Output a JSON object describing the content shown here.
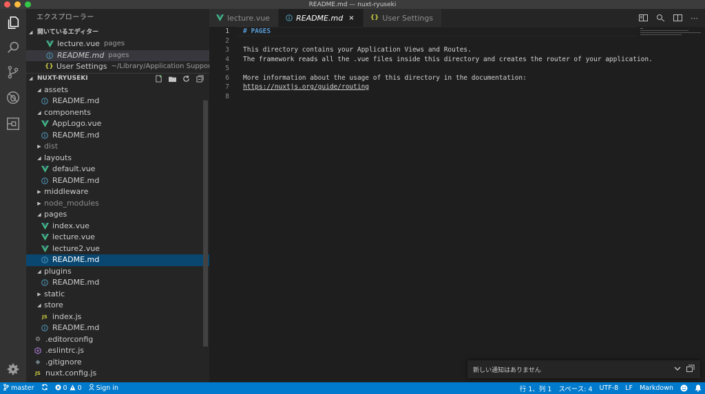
{
  "window": {
    "title": "README.md — nuxt-ryuseki"
  },
  "sidebar": {
    "title": "エクスプローラー",
    "open_editors": {
      "label": "開いているエディター",
      "items": [
        {
          "name": "lecture.vue",
          "desc": "pages",
          "icon": "vue-icon"
        },
        {
          "name": "README.md",
          "desc": "pages",
          "icon": "info-icon"
        },
        {
          "name": "User Settings",
          "desc": "~/Library/Application Support/Code...",
          "icon": "json-icon"
        }
      ]
    },
    "project": {
      "label": "NUXT-RYUSEKI",
      "tree": [
        {
          "name": "assets",
          "type": "folder",
          "open": true,
          "level": 0
        },
        {
          "name": "README.md",
          "type": "md",
          "level": 1
        },
        {
          "name": "components",
          "type": "folder",
          "open": true,
          "level": 0
        },
        {
          "name": "AppLogo.vue",
          "type": "vue",
          "level": 1
        },
        {
          "name": "README.md",
          "type": "md",
          "level": 1
        },
        {
          "name": "dist",
          "type": "folder",
          "open": false,
          "level": 0,
          "muted": true
        },
        {
          "name": "layouts",
          "type": "folder",
          "open": true,
          "level": 0
        },
        {
          "name": "default.vue",
          "type": "vue",
          "level": 1
        },
        {
          "name": "README.md",
          "type": "md",
          "level": 1
        },
        {
          "name": "middleware",
          "type": "folder",
          "open": false,
          "level": 0
        },
        {
          "name": "node_modules",
          "type": "folder",
          "open": false,
          "level": 0,
          "muted": true
        },
        {
          "name": "pages",
          "type": "folder",
          "open": true,
          "level": 0
        },
        {
          "name": "index.vue",
          "type": "vue",
          "level": 1
        },
        {
          "name": "lecture.vue",
          "type": "vue",
          "level": 1
        },
        {
          "name": "lecture2.vue",
          "type": "vue",
          "level": 1
        },
        {
          "name": "README.md",
          "type": "md",
          "level": 1,
          "selected": true
        },
        {
          "name": "plugins",
          "type": "folder",
          "open": true,
          "level": 0
        },
        {
          "name": "README.md",
          "type": "md",
          "level": 1
        },
        {
          "name": "static",
          "type": "folder",
          "open": false,
          "level": 0
        },
        {
          "name": "store",
          "type": "folder",
          "open": true,
          "level": 0
        },
        {
          "name": "index.js",
          "type": "js",
          "level": 1
        },
        {
          "name": "README.md",
          "type": "md",
          "level": 1
        },
        {
          "name": ".editorconfig",
          "type": "config",
          "level": 0
        },
        {
          "name": ".eslintrc.js",
          "type": "eslint",
          "level": 0
        },
        {
          "name": ".gitignore",
          "type": "git",
          "level": 0
        },
        {
          "name": "nuxt.config.js",
          "type": "js",
          "level": 0
        }
      ]
    }
  },
  "tabs": [
    {
      "label": "lecture.vue",
      "icon": "vue-icon",
      "active": false
    },
    {
      "label": "README.md",
      "icon": "info-icon",
      "active": true,
      "close": "×"
    },
    {
      "label": "User Settings",
      "icon": "json-icon",
      "active": false
    }
  ],
  "editor": {
    "lines": [
      {
        "n": "1",
        "text": "# PAGES",
        "kind": "heading"
      },
      {
        "n": "2",
        "text": "",
        "kind": "plain"
      },
      {
        "n": "3",
        "text": "This directory contains your Application Views and Routes.",
        "kind": "plain"
      },
      {
        "n": "4",
        "text": "The framework reads all the .vue files inside this directory and creates the router of your application.",
        "kind": "plain"
      },
      {
        "n": "5",
        "text": "",
        "kind": "plain"
      },
      {
        "n": "6",
        "text": "More information about the usage of this directory in the documentation:",
        "kind": "plain"
      },
      {
        "n": "7",
        "text": "https://nuxtjs.org/guide/routing",
        "kind": "link"
      },
      {
        "n": "8",
        "text": "",
        "kind": "plain"
      }
    ]
  },
  "notification": {
    "text": "新しい通知はありません"
  },
  "statusbar": {
    "branch": "master",
    "errors": "0",
    "warnings": "0",
    "sign_in": "Sign in",
    "position": "行 1、列 1",
    "spaces": "スペース: 4",
    "encoding": "UTF-8",
    "eol": "LF",
    "language": "Markdown"
  },
  "colors": {
    "accent": "#007acc",
    "vue": "#41b883",
    "info": "#519aba",
    "json": "#cbcb41",
    "js": "#cbcb41",
    "selection": "#094771"
  }
}
